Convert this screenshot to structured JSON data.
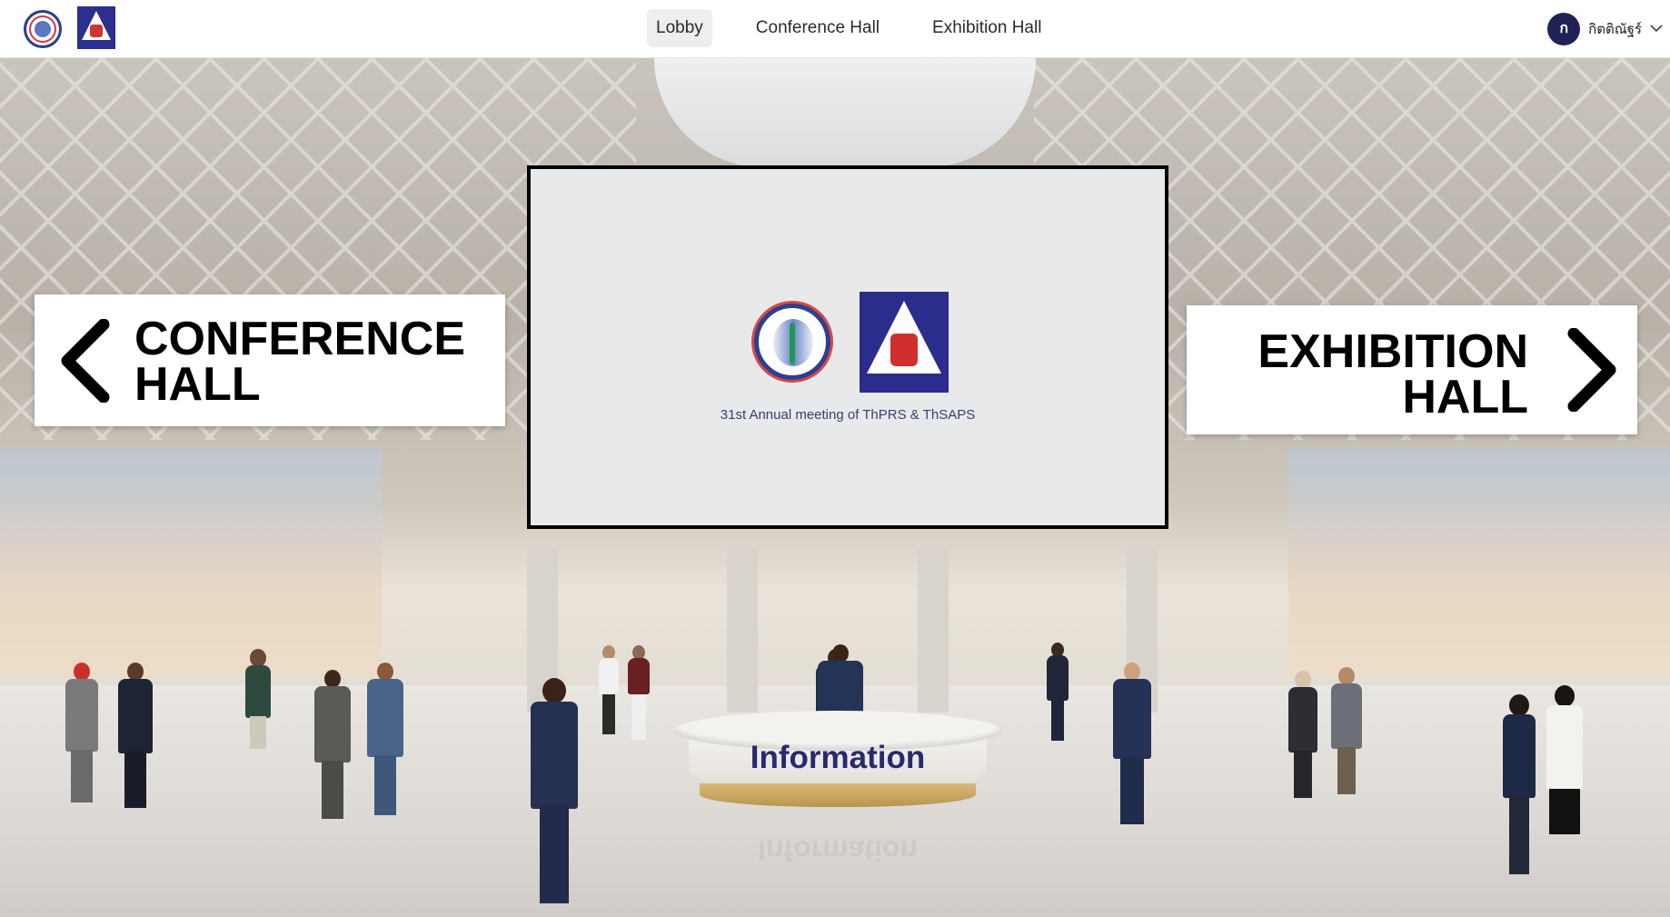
{
  "header": {
    "logos": [
      "society-logo-icon",
      "thsaps-logo-icon"
    ],
    "nav": [
      {
        "label": "Lobby",
        "active": true
      },
      {
        "label": "Conference Hall",
        "active": false
      },
      {
        "label": "Exhibition Hall",
        "active": false
      }
    ],
    "user": {
      "avatar_initial": "ก",
      "name": "กิตติณัฐร์",
      "caret_icon": "chevron-down-icon"
    }
  },
  "lobby": {
    "left_sign": {
      "line1": "CONFERENCE",
      "line2": "HALL",
      "icon": "chevron-left-icon"
    },
    "right_sign": {
      "line1": "EXHIBITION",
      "line2": "HALL",
      "icon": "chevron-right-icon"
    },
    "screen": {
      "caption": "31st Annual meeting of ThPRS & ThSAPS"
    },
    "info_desk": {
      "label": "Information"
    }
  },
  "colors": {
    "navy": "#1e2257",
    "logo_blue": "#2a2d8c",
    "logo_red": "#d02f2f",
    "desk_text": "#29296e"
  }
}
